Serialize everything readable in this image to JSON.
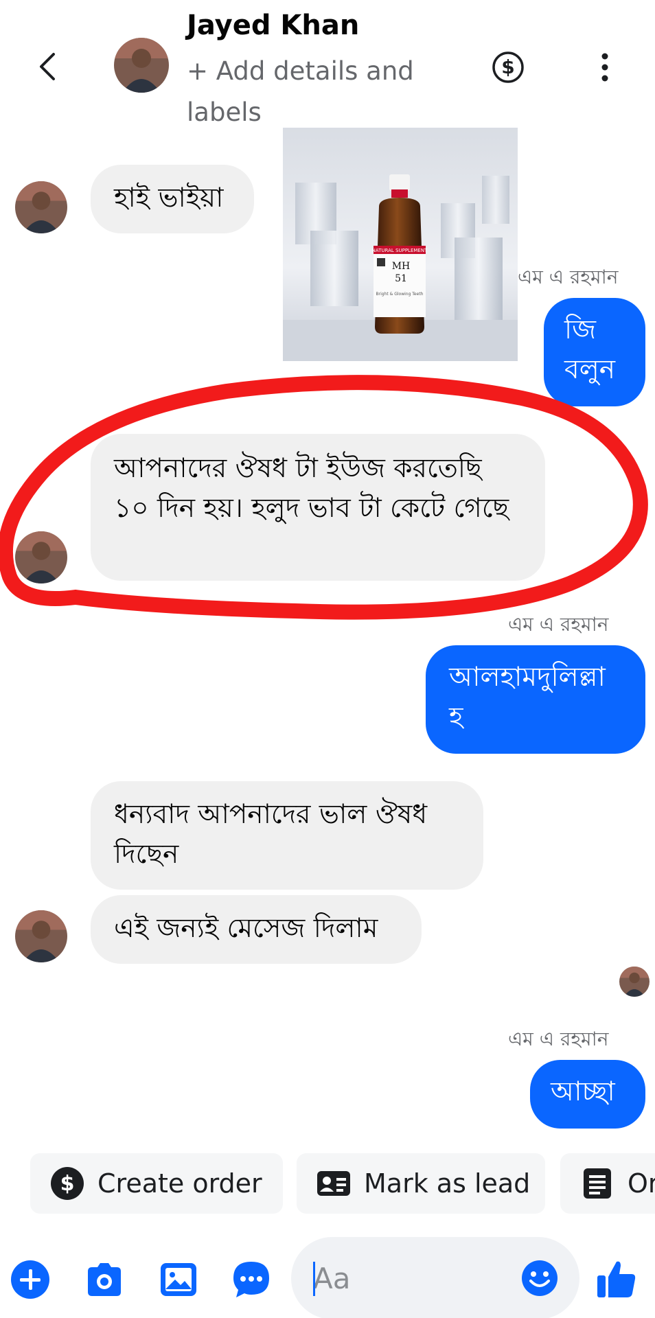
{
  "header": {
    "name": "Jayed Khan",
    "subtitle": "+ Add details and labels"
  },
  "messages": {
    "m1": "হাই ভাইয়া",
    "m2_sender": "এম এ রহমান",
    "m2": "জি বলুন",
    "m3": "আপনাদের ঔষধ টা ইউজ করতেছি ১০ দিন হয়। হলুদ ভাব টা কেটে গেছে",
    "m4_sender": "এম এ রহমান",
    "m4": "আলহামদুলিল্লা হ",
    "m5": "ধন্যবাদ আপনাদের ভাল ঔষধ দিছেন",
    "m6": "এই জন্যই মেসেজ দিলাম",
    "m7_sender": "এম এ রহমান",
    "m7": "আচ্ছা"
  },
  "product": {
    "band_text": "NATURAL SUPPLEMENT",
    "code_line1": "MH",
    "code_line2": "51",
    "caption": "Bright & Glowing Teeth"
  },
  "actions": {
    "create_order": "Create order",
    "mark_as_lead": "Mark as lead",
    "third": "Or"
  },
  "composer": {
    "placeholder": "Aa"
  },
  "colors": {
    "accent": "#0a66ff",
    "incoming_bubble": "#f0f0f0",
    "annotation": "#f21b1b"
  },
  "icons": [
    "back-chevron-icon",
    "dollar-circle-icon",
    "more-vertical-icon",
    "plus-circle-icon",
    "camera-icon",
    "image-icon",
    "chat-more-icon",
    "emoji-icon",
    "thumbs-up-icon",
    "id-card-icon",
    "document-icon"
  ]
}
